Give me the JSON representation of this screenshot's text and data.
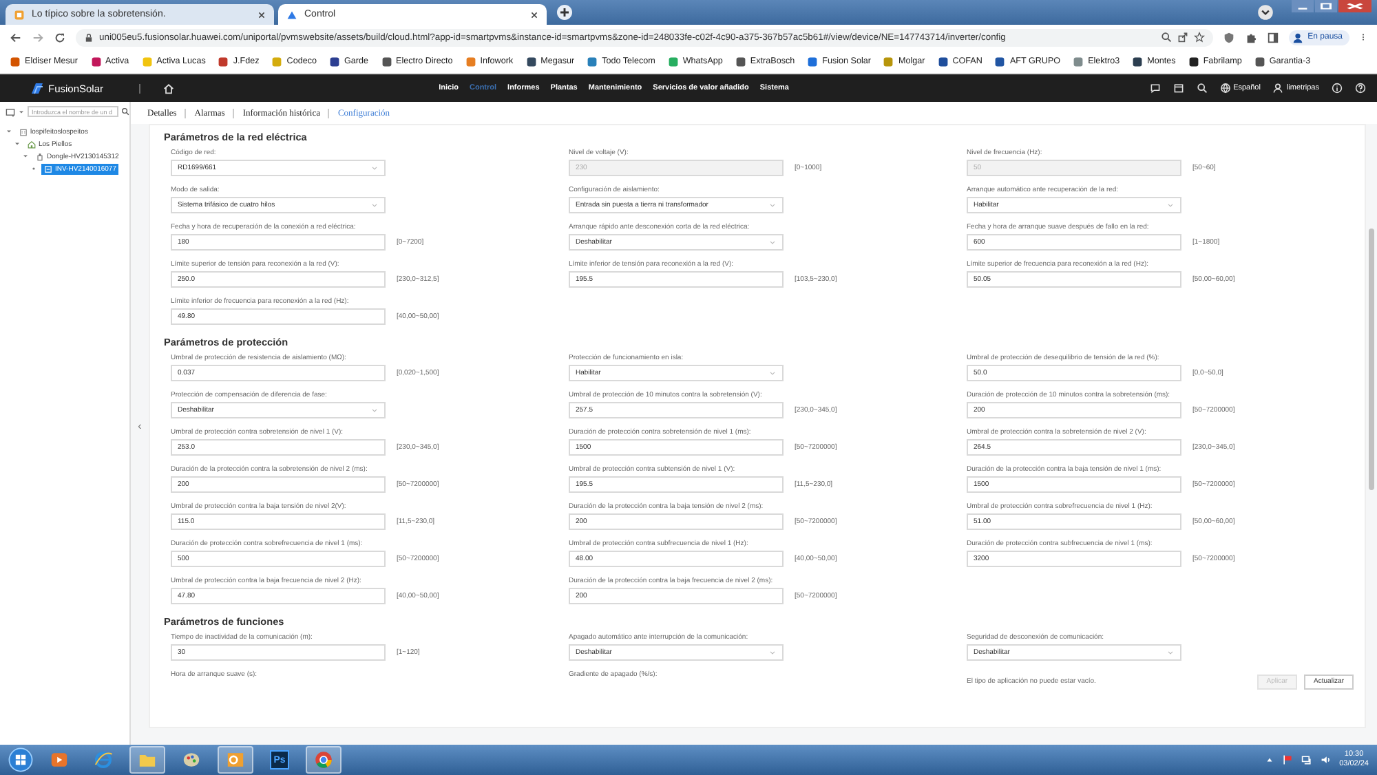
{
  "browser": {
    "tabs": [
      {
        "title": "Lo típico sobre la sobretensión.",
        "kind": "page",
        "selected": false
      },
      {
        "title": "Control",
        "kind": "app",
        "selected": true
      }
    ],
    "url": "uni005eu5.fusionsolar.huawei.com/uniportal/pvmswebsite/assets/build/cloud.html?app-id=smartpvms&instance-id=smartpvms&zone-id=248033fe-c02f-4c90-a375-367b57ac5b61#/view/device/NE=147743714/inverter/config",
    "profile": "En pausa",
    "bookmarks": [
      {
        "label": "Eldiser Mesur",
        "color": "#d35400"
      },
      {
        "label": "Activa",
        "color": "#c2185b"
      },
      {
        "label": "Activa Lucas",
        "color": "#f1c40f"
      },
      {
        "label": "J.Fdez",
        "color": "#c0392b"
      },
      {
        "label": "Codeco",
        "color": "#d4ac0d"
      },
      {
        "label": "Garde",
        "color": "#2c3e91"
      },
      {
        "label": "Electro Directo",
        "color": "#555555"
      },
      {
        "label": "Infowork",
        "color": "#e67e22"
      },
      {
        "label": "Megasur",
        "color": "#34495e"
      },
      {
        "label": "Todo Telecom",
        "color": "#2980b9"
      },
      {
        "label": "WhatsApp",
        "color": "#27ae60"
      },
      {
        "label": "ExtraBosch",
        "color": "#555555"
      },
      {
        "label": "Fusion Solar",
        "color": "#1e6fd9"
      },
      {
        "label": "Molgar",
        "color": "#b7950b"
      },
      {
        "label": "COFAN",
        "color": "#1f4e9c"
      },
      {
        "label": "AFT GRUPO",
        "color": "#2155a3"
      },
      {
        "label": "Elektro3",
        "color": "#7f8c8d"
      },
      {
        "label": "Montes",
        "color": "#2c3e50"
      },
      {
        "label": "Fabrilamp",
        "color": "#222222"
      },
      {
        "label": "Garantia-3",
        "color": "#555555"
      }
    ]
  },
  "app": {
    "logo": "FusionSolar",
    "nav": [
      {
        "label": "Inicio",
        "selected": false
      },
      {
        "label": "Control",
        "selected": true
      },
      {
        "label": "Informes",
        "selected": false
      },
      {
        "label": "Plantas",
        "selected": false
      },
      {
        "label": "Mantenimiento",
        "selected": false
      },
      {
        "label": "Servicios de valor añadido",
        "selected": false
      },
      {
        "label": "Sistema",
        "selected": false
      }
    ],
    "language": "Español",
    "user": "limetripas"
  },
  "sidebar": {
    "search_placeholder": "Introduzca el nombre de un d",
    "tree": [
      {
        "label": "lospifeitoslospeitos",
        "kind": "company",
        "expanded": true,
        "selected": false,
        "children": [
          {
            "label": "Los Piellos",
            "kind": "plant",
            "expanded": true,
            "selected": false,
            "children": [
              {
                "label": "Dongle-HV2130145312",
                "kind": "dongle",
                "expanded": true,
                "selected": false,
                "children": [
                  {
                    "label": "INV-HV2140016077",
                    "kind": "inverter",
                    "selected": true
                  }
                ]
              }
            ]
          }
        ]
      }
    ],
    "collapse_glyph": "‹"
  },
  "subtabs": [
    {
      "label": "Detalles",
      "selected": false
    },
    {
      "label": "Alarmas",
      "selected": false
    },
    {
      "label": "Información histórica",
      "selected": false
    },
    {
      "label": "Configuración",
      "selected": true
    }
  ],
  "sections": [
    {
      "title": "Parámetros de la red eléctrica",
      "fields": [
        {
          "label": "Código de red:",
          "kind": "select",
          "value": "RD1699/661",
          "disabled": false
        },
        {
          "label": "Nivel de voltaje (V):",
          "kind": "input",
          "value": "230",
          "range": "[0~1000]",
          "disabled": true
        },
        {
          "label": "Nivel de frecuencia (Hz):",
          "kind": "input",
          "value": "50",
          "range": "[50~60]",
          "disabled": true
        },
        {
          "label": "Modo de salida:",
          "kind": "select",
          "value": "Sistema trifásico de cuatro hilos",
          "disabled": false
        },
        {
          "label": "Configuración de aislamiento:",
          "kind": "select",
          "value": "Entrada sin puesta a tierra ni transformador",
          "disabled": false
        },
        {
          "label": "Arranque automático ante recuperación de la red:",
          "kind": "select",
          "value": "Habilitar",
          "disabled": false
        },
        {
          "label": "Fecha y hora de recuperación de la conexión a red eléctrica:",
          "kind": "input",
          "value": "180",
          "range": "[0~7200]",
          "disabled": false
        },
        {
          "label": "Arranque rápido ante desconexión corta de la red eléctrica:",
          "kind": "select",
          "value": "Deshabilitar",
          "disabled": false
        },
        {
          "label": "Fecha y hora de arranque suave después de fallo en la red:",
          "kind": "input",
          "value": "600",
          "range": "[1~1800]",
          "disabled": false
        },
        {
          "label": "Límite superior de tensión para reconexión a la red (V):",
          "kind": "input",
          "value": "250.0",
          "range": "[230,0~312,5]",
          "disabled": false
        },
        {
          "label": "Límite inferior de tensión para reconexión a la red (V):",
          "kind": "input",
          "value": "195.5",
          "range": "[103,5~230,0]",
          "disabled": false
        },
        {
          "label": "Límite superior de frecuencia para reconexión a la red (Hz):",
          "kind": "input",
          "value": "50.05",
          "range": "[50,00~60,00]",
          "disabled": false
        },
        {
          "label": "Límite inferior de frecuencia para reconexión a la red (Hz):",
          "kind": "input",
          "value": "49.80",
          "range": "[40,00~50,00]",
          "disabled": false
        }
      ]
    },
    {
      "title": "Parámetros de protección",
      "fields": [
        {
          "label": "Umbral de protección de resistencia de aislamiento (MΩ):",
          "kind": "input",
          "value": "0.037",
          "range": "[0,020~1,500]",
          "disabled": false
        },
        {
          "label": "Protección de funcionamiento en isla:",
          "kind": "select",
          "value": "Habilitar",
          "disabled": false
        },
        {
          "label": "Umbral de protección de desequilibrio de tensión de la red (%):",
          "kind": "input",
          "value": "50.0",
          "range": "[0,0~50,0]",
          "disabled": false
        },
        {
          "label": "Protección de compensación de diferencia de fase:",
          "kind": "select",
          "value": "Deshabilitar",
          "disabled": false
        },
        {
          "label": "Umbral de protección de 10 minutos contra la sobretensión (V):",
          "kind": "input",
          "value": "257.5",
          "range": "[230,0~345,0]",
          "disabled": false
        },
        {
          "label": "Duración de protección de 10 minutos contra la sobretensión (ms):",
          "kind": "input",
          "value": "200",
          "range": "[50~7200000]",
          "disabled": false
        },
        {
          "label": "Umbral de protección contra sobretensión de nivel 1 (V):",
          "kind": "input",
          "value": "253.0",
          "range": "[230,0~345,0]",
          "disabled": false
        },
        {
          "label": "Duración de protección contra sobretensión de nivel 1 (ms):",
          "kind": "input",
          "value": "1500",
          "range": "[50~7200000]",
          "disabled": false
        },
        {
          "label": "Umbral de protección contra la sobretensión de nivel 2 (V):",
          "kind": "input",
          "value": "264.5",
          "range": "[230,0~345,0]",
          "disabled": false
        },
        {
          "label": "Duración de la protección contra la sobretensión de nivel 2 (ms):",
          "kind": "input",
          "value": "200",
          "range": "[50~7200000]",
          "disabled": false
        },
        {
          "label": "Umbral de protección contra subtensión de nivel 1 (V):",
          "kind": "input",
          "value": "195.5",
          "range": "[11,5~230,0]",
          "disabled": false
        },
        {
          "label": "Duración de la protección contra la baja tensión de nivel 1 (ms):",
          "kind": "input",
          "value": "1500",
          "range": "[50~7200000]",
          "disabled": false
        },
        {
          "label": "Umbral de protección contra la baja tensión de nivel 2(V):",
          "kind": "input",
          "value": "115.0",
          "range": "[11,5~230,0]",
          "disabled": false
        },
        {
          "label": "Duración de la protección contra la baja tensión de nivel 2 (ms):",
          "kind": "input",
          "value": "200",
          "range": "[50~7200000]",
          "disabled": false
        },
        {
          "label": "Umbral de protección contra sobrefrecuencia de nivel 1 (Hz):",
          "kind": "input",
          "value": "51.00",
          "range": "[50,00~60,00]",
          "disabled": false
        },
        {
          "label": "Duración de protección contra sobrefrecuencia de nivel 1 (ms):",
          "kind": "input",
          "value": "500",
          "range": "[50~7200000]",
          "disabled": false
        },
        {
          "label": "Umbral de protección contra subfrecuencia de nivel 1 (Hz):",
          "kind": "input",
          "value": "48.00",
          "range": "[40,00~50,00]",
          "disabled": false
        },
        {
          "label": "Duración de protección contra subfrecuencia de nivel 1 (ms):",
          "kind": "input",
          "value": "3200",
          "range": "[50~7200000]",
          "disabled": false
        },
        {
          "label": "Umbral de protección contra la baja frecuencia de nivel 2 (Hz):",
          "kind": "input",
          "value": "47.80",
          "range": "[40,00~50,00]",
          "disabled": false
        },
        {
          "label": "Duración de la protección contra la baja frecuencia de nivel 2 (ms):",
          "kind": "input",
          "value": "200",
          "range": "[50~7200000]",
          "disabled": false
        }
      ]
    },
    {
      "title": "Parámetros de funciones",
      "fields": [
        {
          "label": "Tiempo de inactividad de la comunicación (m):",
          "kind": "input",
          "value": "30",
          "range": "[1~120]",
          "disabled": false
        },
        {
          "label": "Apagado automático ante interrupción de la comunicación:",
          "kind": "select",
          "value": "Deshabilitar",
          "disabled": false
        },
        {
          "label": "Seguridad de desconexión de comunicación:",
          "kind": "select",
          "value": "Deshabilitar",
          "disabled": false
        },
        {
          "label": "Hora de arranque suave (s):",
          "kind": "label"
        },
        {
          "label": "Gradiente de apagado (%/s):",
          "kind": "label"
        },
        {
          "label": "El tipo de aplicación no puede estar vacío.",
          "kind": "message"
        }
      ],
      "buttons": [
        {
          "label": "Aplicar",
          "disabled": true
        },
        {
          "label": "Actualizar",
          "disabled": false
        }
      ]
    }
  ],
  "taskbar": {
    "apps": [
      {
        "kind": "media",
        "selected": false
      },
      {
        "kind": "browser-e",
        "selected": false
      },
      {
        "kind": "folder",
        "selected": true
      },
      {
        "kind": "paint",
        "selected": false
      },
      {
        "kind": "mail",
        "selected": true
      },
      {
        "kind": "photo",
        "label": "Ps",
        "selected": false
      },
      {
        "kind": "chrome",
        "selected": true
      }
    ],
    "time": "10:30",
    "date": "03/02/24"
  }
}
